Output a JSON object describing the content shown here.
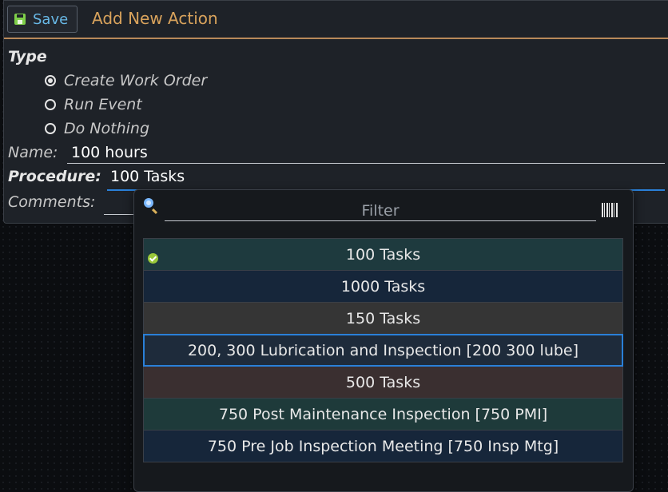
{
  "toolbar": {
    "save_label": "Save",
    "title": "Add New Action"
  },
  "form": {
    "type_label": "Type",
    "type_options": [
      {
        "label": "Create Work Order",
        "checked": true
      },
      {
        "label": "Run Event",
        "checked": false
      },
      {
        "label": "Do Nothing",
        "checked": false
      }
    ],
    "name_label": "Name:",
    "name_value": "100 hours",
    "procedure_label": "Procedure:",
    "procedure_value": "100 Tasks",
    "comments_label": "Comments:"
  },
  "dropdown": {
    "filter_placeholder": "Filter",
    "options": [
      {
        "label": "100 Tasks",
        "bg": "#1e3a3e",
        "checked": true
      },
      {
        "label": "1000 Tasks",
        "bg": "#16263a",
        "checked": false
      },
      {
        "label": "150 Tasks",
        "bg": "#353535",
        "checked": false
      },
      {
        "label": "200, 300 Lubrication and Inspection [200 300 lube]",
        "bg": "#1e2b3b",
        "checked": false,
        "highlighted": true
      },
      {
        "label": "500 Tasks",
        "bg": "#3a2f30",
        "checked": false
      },
      {
        "label": "750 Post Maintenance Inspection [750 PMI]",
        "bg": "#1e3a3a",
        "checked": false
      },
      {
        "label": "750 Pre Job Inspection Meeting [750 Insp Mtg]",
        "bg": "#16263a",
        "checked": false
      }
    ]
  },
  "colors": {
    "accent_title": "#d9a35c",
    "save_text": "#68b8e6",
    "focus_blue": "#2a80d8",
    "check_green": "#9ac83a"
  }
}
